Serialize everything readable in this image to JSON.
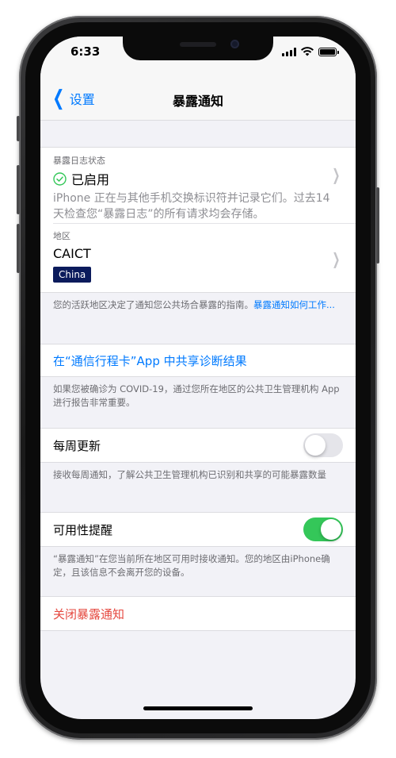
{
  "status_bar": {
    "time": "6:33"
  },
  "nav": {
    "back_label": "设置",
    "title": "暴露通知"
  },
  "exposure_logging": {
    "section_label": "暴露日志状态",
    "status": "已启用",
    "description": "iPhone 正在与其他手机交换标识符并记录它们。过去14天检查您“暴露日志”的所有请求均会存储。"
  },
  "region": {
    "section_label": "地区",
    "name": "CAICT",
    "badge": "China"
  },
  "region_footer": {
    "text": "您的活跃地区决定了通知您公共场合暴露的指南。",
    "link": "暴露通知如何工作..."
  },
  "share": {
    "label": "在“通信行程卡”App 中共享诊断结果",
    "footer": "如果您被确诊为 COVID-19，通过您所在地区的公共卫生管理机构 App 进行报告非常重要。"
  },
  "weekly": {
    "label": "每周更新",
    "enabled": false,
    "footer": "接收每周通知，了解公共卫生管理机构已识别和共享的可能暴露数量"
  },
  "availability": {
    "label": "可用性提醒",
    "enabled": true,
    "footer": "“暴露通知”在您当前所在地区可用时接收通知。您的地区由iPhone确定，且该信息不会离开您的设备。"
  },
  "turn_off": {
    "label": "关闭暴露通知"
  },
  "colors": {
    "accent": "#007aff",
    "toggle_on": "#34c759",
    "destructive": "#e5483f",
    "badge_bg": "#0b1b5c"
  }
}
